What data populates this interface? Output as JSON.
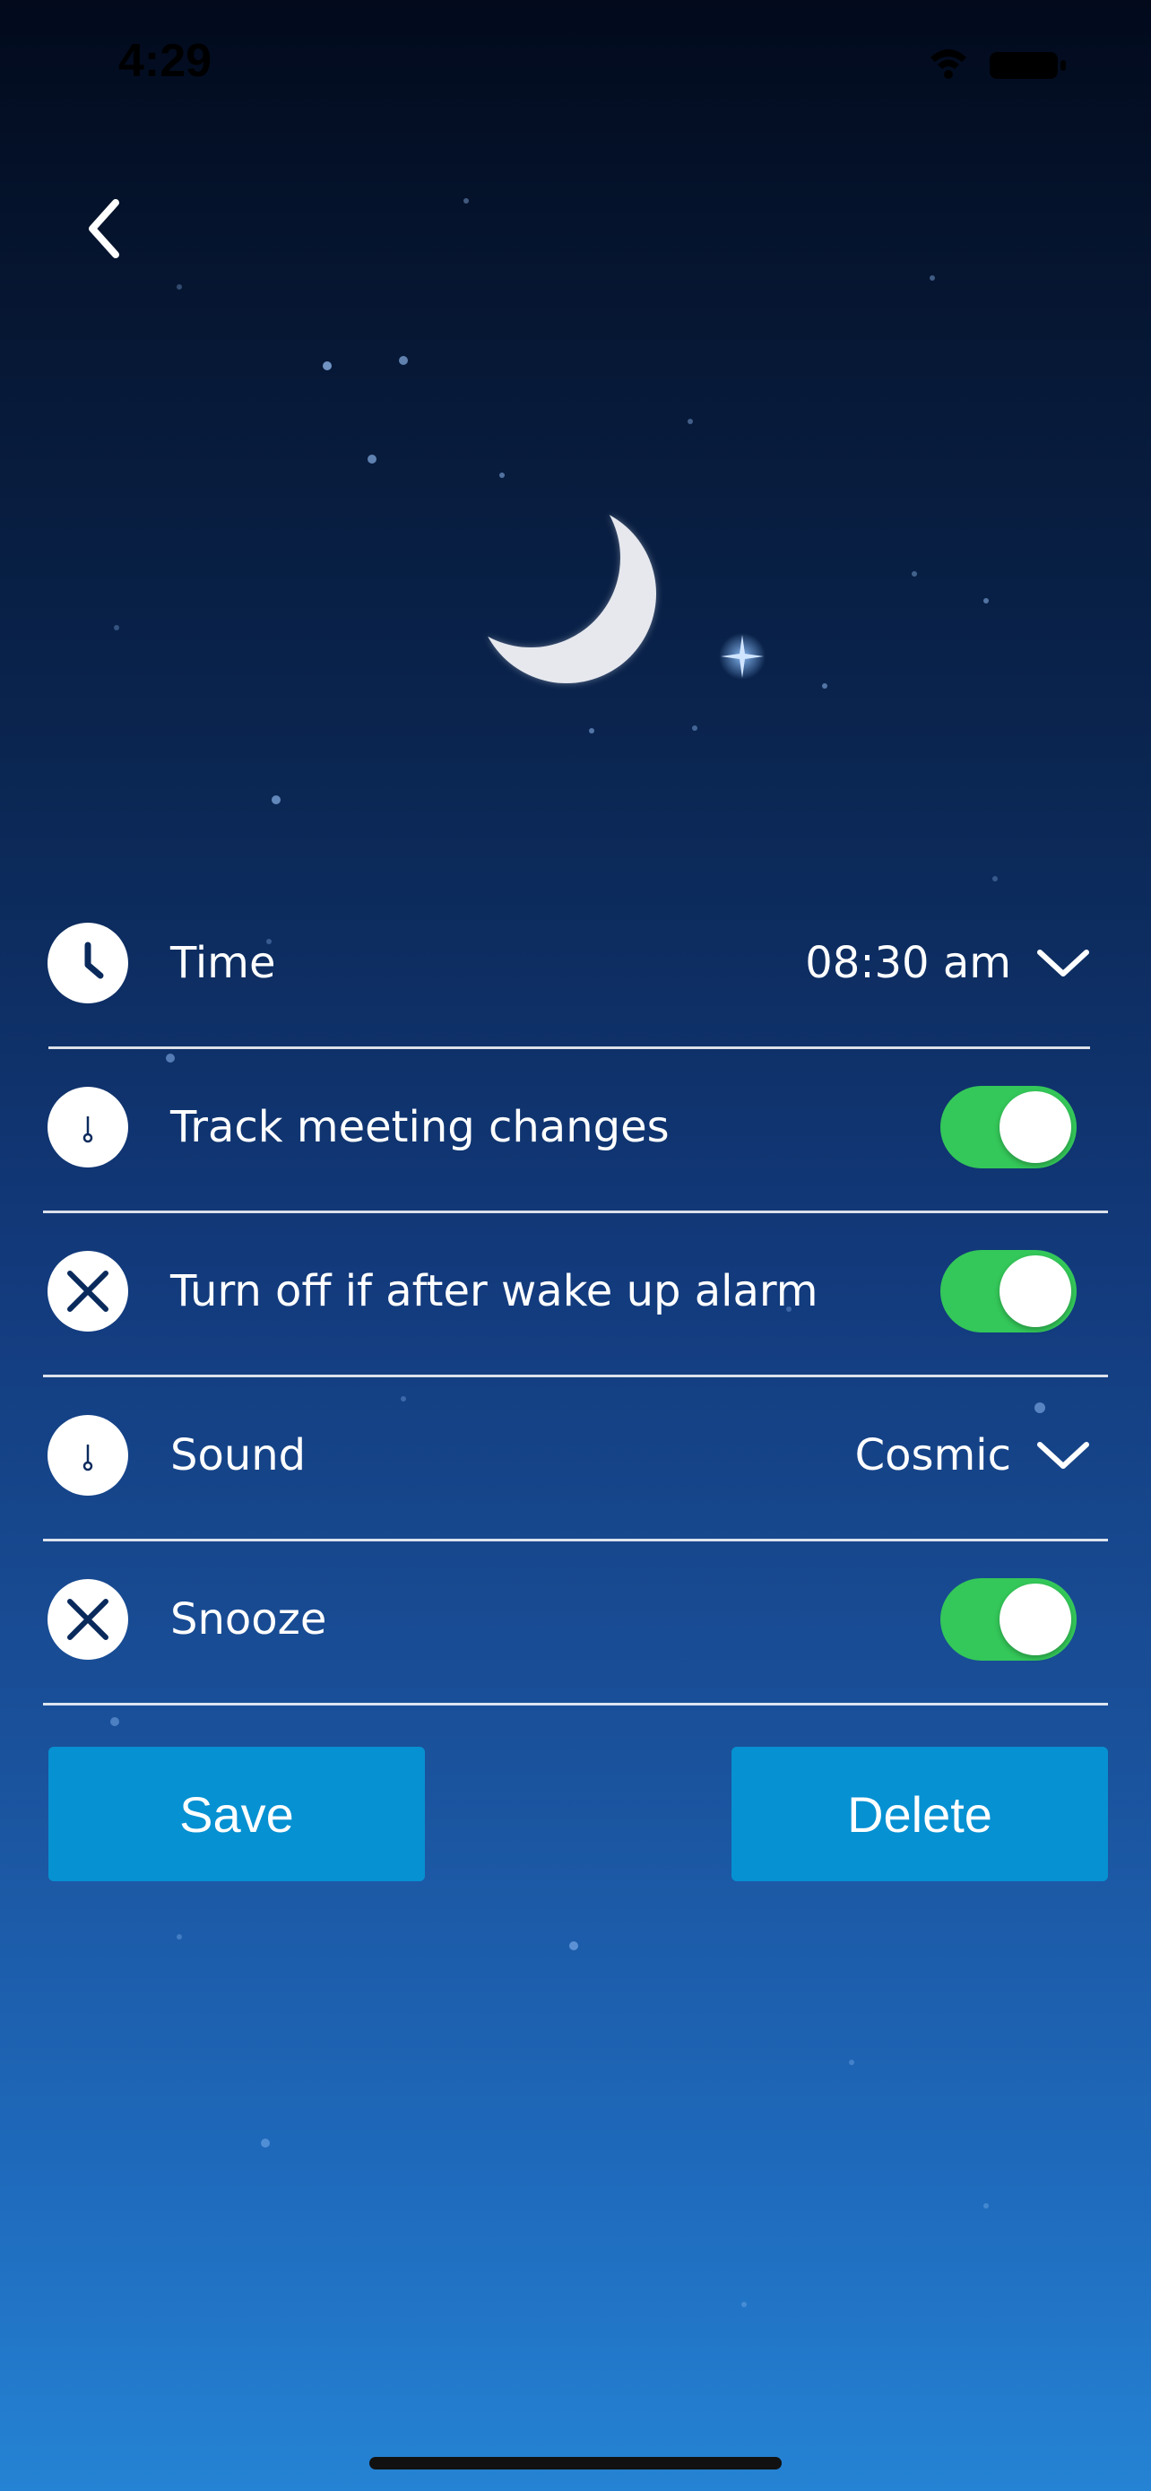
{
  "status_bar": {
    "time": "4:29",
    "icons": [
      "wifi-icon",
      "battery-icon"
    ]
  },
  "header": {
    "back_icon": "chevron-left-icon"
  },
  "hero": {
    "image": "crescent-moon-night-sky"
  },
  "settings": [
    {
      "icon": "clock-icon",
      "label": "Time",
      "value": "08:30 am",
      "control": "dropdown"
    },
    {
      "icon": "stopwatch-icon",
      "label": "Track meeting changes",
      "control": "toggle",
      "on": true
    },
    {
      "icon": "close-icon",
      "label": "Turn off if after wake up alarm",
      "control": "toggle",
      "on": true
    },
    {
      "icon": "stopwatch-icon",
      "label": "Sound",
      "value": "Cosmic",
      "control": "dropdown"
    },
    {
      "icon": "close-icon",
      "label": "Snooze",
      "control": "toggle",
      "on": true
    }
  ],
  "actions": {
    "save_label": "Save",
    "delete_label": "Delete"
  },
  "colors": {
    "toggle_on": "#34c759",
    "button_bg": "#0691d2",
    "icon_fg": "#0a2a5c",
    "background_top": "#020a1c",
    "background_bottom": "#2583d4"
  }
}
